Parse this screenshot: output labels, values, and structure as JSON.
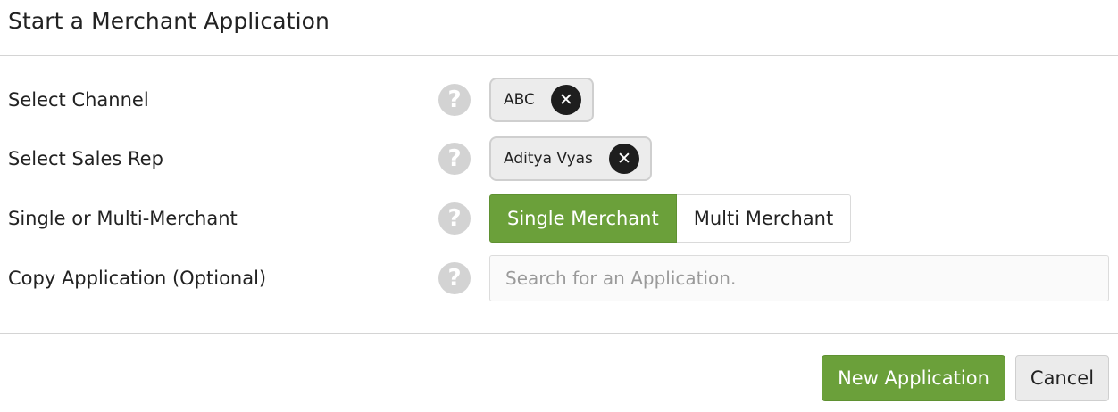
{
  "modal": {
    "title": "Start a Merchant Application"
  },
  "form": {
    "channel": {
      "label": "Select Channel",
      "help_icon": "question-circle-icon",
      "selected_tag": "ABC",
      "remove_icon": "close-icon"
    },
    "sales_rep": {
      "label": "Select Sales Rep",
      "help_icon": "question-circle-icon",
      "selected_tag": "Aditya Vyas",
      "remove_icon": "close-icon"
    },
    "merchant_type": {
      "label": "Single or Multi-Merchant",
      "help_icon": "question-circle-icon",
      "options": [
        "Single Merchant",
        "Multi Merchant"
      ],
      "selected": "Single Merchant"
    },
    "copy_application": {
      "label": "Copy Application (Optional)",
      "help_icon": "question-circle-icon",
      "value": "",
      "placeholder": "Search for an Application."
    }
  },
  "footer": {
    "new_application_label": "New Application",
    "cancel_label": "Cancel"
  },
  "colors": {
    "primary_green": "#6ba03a",
    "help_icon_gray": "#d3d3d3",
    "tag_background": "#ececec",
    "tag_remove_dark": "#1e1e1e",
    "divider": "#d4d4d4"
  }
}
